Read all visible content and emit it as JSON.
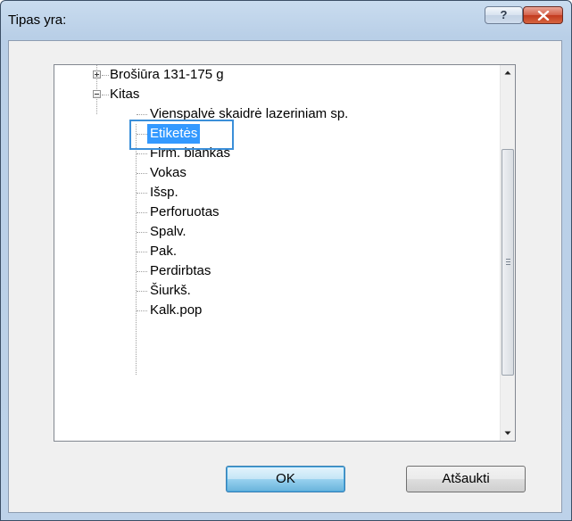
{
  "window": {
    "title": "Tipas yra:",
    "help_label": "?"
  },
  "tree": {
    "items": [
      {
        "label": "Brošiūra 131-175 g",
        "expander": "+"
      },
      {
        "label": "Kitas",
        "expander": "-"
      },
      {
        "label": "Vienspalvė skaidrė lazeriniam sp."
      },
      {
        "label": "Etiketės",
        "selected": true
      },
      {
        "label": "Firm. blankas"
      },
      {
        "label": "Vokas"
      },
      {
        "label": "Išsp."
      },
      {
        "label": "Perforuotas"
      },
      {
        "label": "Spalv."
      },
      {
        "label": "Pak."
      },
      {
        "label": "Perdirbtas"
      },
      {
        "label": "Šiurkš."
      },
      {
        "label": "Kalk.pop"
      }
    ]
  },
  "buttons": {
    "ok": "OK",
    "cancel": "Atšaukti"
  },
  "colors": {
    "selection": "#3399ff",
    "focus_highlight": "#3b8fd9",
    "title_bar": "#bdd2e9"
  }
}
